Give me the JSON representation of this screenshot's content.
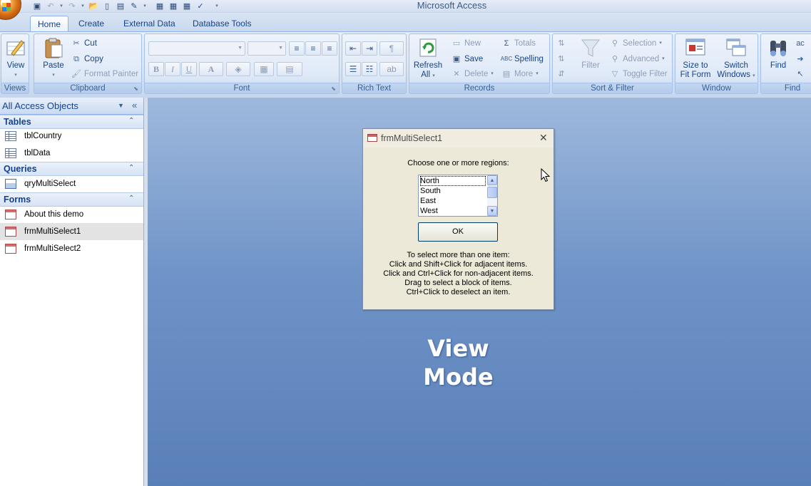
{
  "app": {
    "window_title": "Microsoft Access"
  },
  "quick_access": {
    "icons": [
      "save-icon",
      "undo-icon",
      "redo-icon",
      "open-icon",
      "new-icon",
      "properties-icon",
      "format-icon",
      "table-icon",
      "query-icon",
      "form-icon",
      "spelling-icon",
      "customize-icon"
    ]
  },
  "tabs": [
    {
      "label": "Home"
    },
    {
      "label": "Create"
    },
    {
      "label": "External Data"
    },
    {
      "label": "Database Tools"
    }
  ],
  "ribbon": {
    "views": {
      "label": "Views",
      "view_button": "View"
    },
    "clipboard": {
      "label": "Clipboard",
      "paste": "Paste",
      "cut": "Cut",
      "copy": "Copy",
      "format_painter": "Format Painter"
    },
    "font": {
      "label": "Font",
      "bold": "B",
      "italic": "I",
      "underline": "U",
      "font_color": "A"
    },
    "rich_text": {
      "label": "Rich Text"
    },
    "records": {
      "label": "Records",
      "refresh": "Refresh",
      "refresh_sub": "All",
      "new": "New",
      "save": "Save",
      "delete": "Delete",
      "totals": "Totals",
      "spelling": "Spelling",
      "more": "More"
    },
    "sort_filter": {
      "label": "Sort & Filter",
      "filter": "Filter",
      "selection": "Selection",
      "advanced": "Advanced",
      "toggle_filter": "Toggle Filter"
    },
    "window": {
      "label": "Window",
      "size_to_fit": "Size to",
      "size_to_fit_2": "Fit Form",
      "switch_windows": "Switch",
      "switch_windows_2": "Windows"
    },
    "find": {
      "label": "Find",
      "find_button": "Find"
    }
  },
  "nav": {
    "title": "All Access Objects",
    "groups": [
      {
        "label": "Tables",
        "items": [
          "tblCountry",
          "tblData"
        ]
      },
      {
        "label": "Queries",
        "items": [
          "qryMultiSelect"
        ]
      },
      {
        "label": "Forms",
        "items": [
          "About this demo",
          "frmMultiSelect1",
          "frmMultiSelect2"
        ]
      }
    ],
    "selected_item": "frmMultiSelect1"
  },
  "dialog": {
    "title": "frmMultiSelect1",
    "prompt": "Choose one or more regions:",
    "list_items": [
      "North",
      "South",
      "East",
      "West"
    ],
    "ok_label": "OK",
    "instructions": [
      "To select more than one item:",
      "Click and Shift+Click for adjacent items.",
      "Click and Ctrl+Click for non-adjacent items.",
      "Drag to select a block of items.",
      "Ctrl+Click to deselect an item."
    ]
  },
  "watermark": {
    "line1": "View",
    "line2": "Mode"
  },
  "colors": {
    "accent": "#15428b",
    "workspace_top": "#9fb9dd",
    "workspace_bottom": "#5a7fb8",
    "dialog_bg": "#ece9d8"
  }
}
